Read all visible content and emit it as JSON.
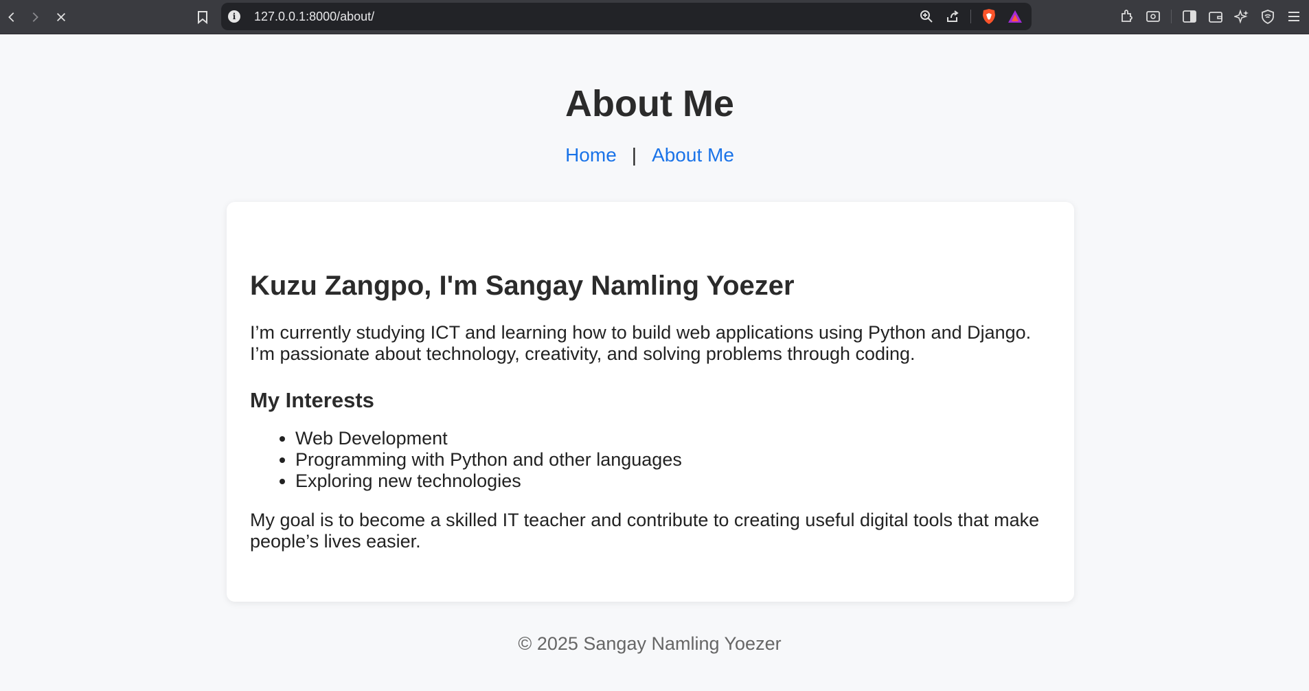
{
  "browser": {
    "url": "127.0.0.1:8000/about/",
    "info_glyph": "i"
  },
  "header": {
    "title": "About Me",
    "nav": [
      {
        "label": "Home"
      },
      {
        "label": "About Me"
      }
    ],
    "nav_separator": "|"
  },
  "card": {
    "heading": "Kuzu Zangpo, I'm Sangay Namling Yoezer",
    "intro": "I’m currently studying ICT and learning how to build web applications using Python and Django. I’m passionate about technology, creativity, and solving problems through coding.",
    "interests_heading": "My Interests",
    "interests": [
      "Web Development",
      "Programming with Python and other languages",
      "Exploring new technologies"
    ],
    "goal": "My goal is to become a skilled IT teacher and contribute to creating useful digital tools that make people’s lives easier."
  },
  "footer": {
    "text": "© 2025 Sangay Namling Yoezer"
  },
  "colors": {
    "link": "#1a73e8",
    "page_bg": "#f7f8fa",
    "chrome_bg": "#3a3b40"
  }
}
